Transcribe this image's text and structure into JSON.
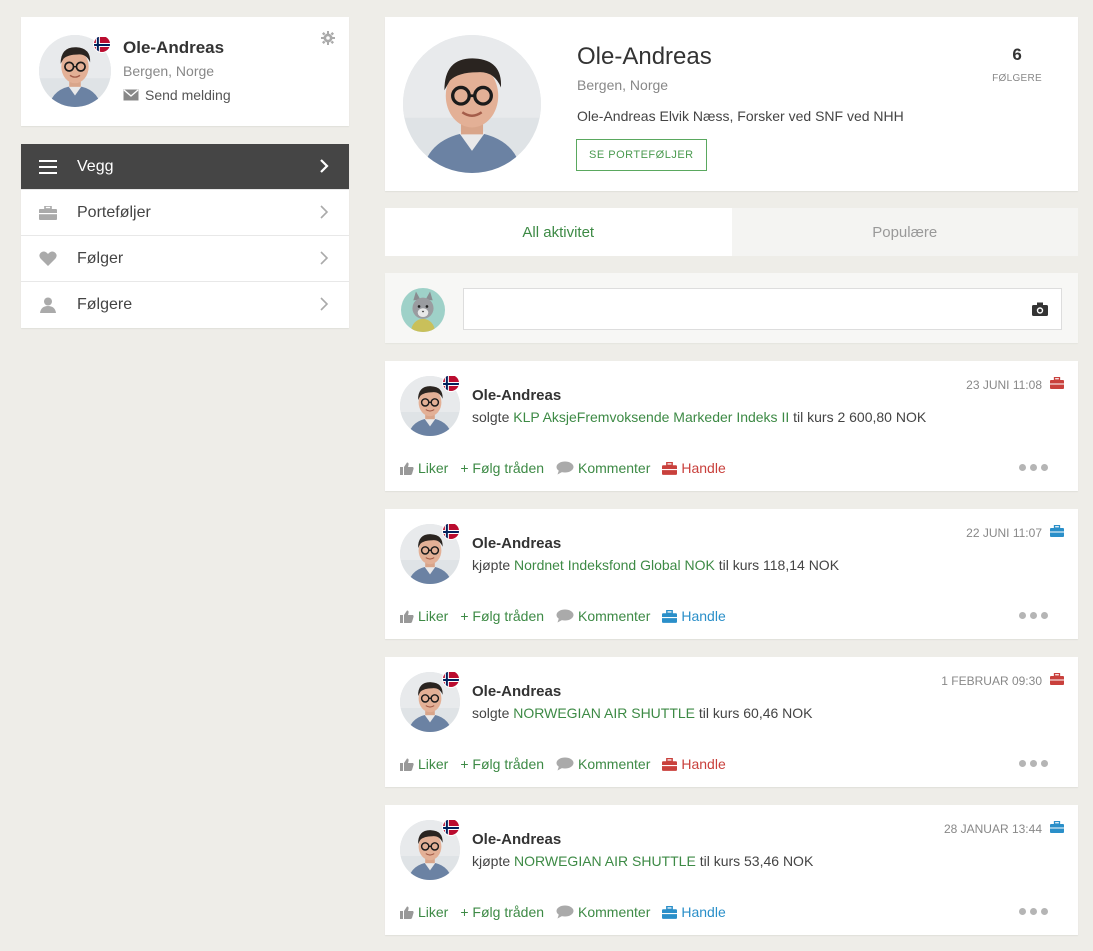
{
  "user": {
    "name": "Ole-Andreas",
    "location": "Bergen, Norge",
    "send_message": "Send melding",
    "description": "Ole-Andreas Elvik Næss, Forsker ved SNF ved NHH",
    "portfolios_button": "SE PORTEFØLJER",
    "followers_count": "6",
    "followers_label": "FØLGERE"
  },
  "nav": {
    "items": [
      {
        "label": "Vegg",
        "icon": "menu-icon",
        "active": true
      },
      {
        "label": "Porteføljer",
        "icon": "briefcase-icon",
        "active": false
      },
      {
        "label": "Følger",
        "icon": "heart-icon",
        "active": false
      },
      {
        "label": "Følgere",
        "icon": "person-icon",
        "active": false
      }
    ]
  },
  "tabs": [
    {
      "label": "All aktivitet",
      "active": true
    },
    {
      "label": "Populære",
      "active": false
    }
  ],
  "composer": {
    "placeholder": ""
  },
  "actions": {
    "like": "Liker",
    "follow": "+ Følg tråden",
    "comment": "Kommenter",
    "trade": "Handle"
  },
  "colors": {
    "accent_green": "#3d8a45",
    "sell_red": "#c9403c",
    "buy_blue": "#2a8fc9",
    "nav_active": "#454545"
  },
  "posts": [
    {
      "name": "Ole-Andreas",
      "verb": "solgte",
      "instrument": "KLP AksjeFremvoksende Markeder Indeks II",
      "rest": "til kurs 2 600,80 NOK",
      "time": "23 JUNI 11:08",
      "type": "sold"
    },
    {
      "name": "Ole-Andreas",
      "verb": "kjøpte",
      "instrument": "Nordnet Indeksfond Global NOK",
      "rest": "til kurs 118,14 NOK",
      "time": "22 JUNI 11:07",
      "type": "bought"
    },
    {
      "name": "Ole-Andreas",
      "verb": "solgte",
      "instrument": "NORWEGIAN AIR SHUTTLE",
      "rest": "til kurs 60,46 NOK",
      "time": "1 FEBRUAR 09:30",
      "type": "sold"
    },
    {
      "name": "Ole-Andreas",
      "verb": "kjøpte",
      "instrument": "NORWEGIAN AIR SHUTTLE",
      "rest": "til kurs 53,46 NOK",
      "time": "28 JANUAR 13:44",
      "type": "bought"
    }
  ]
}
